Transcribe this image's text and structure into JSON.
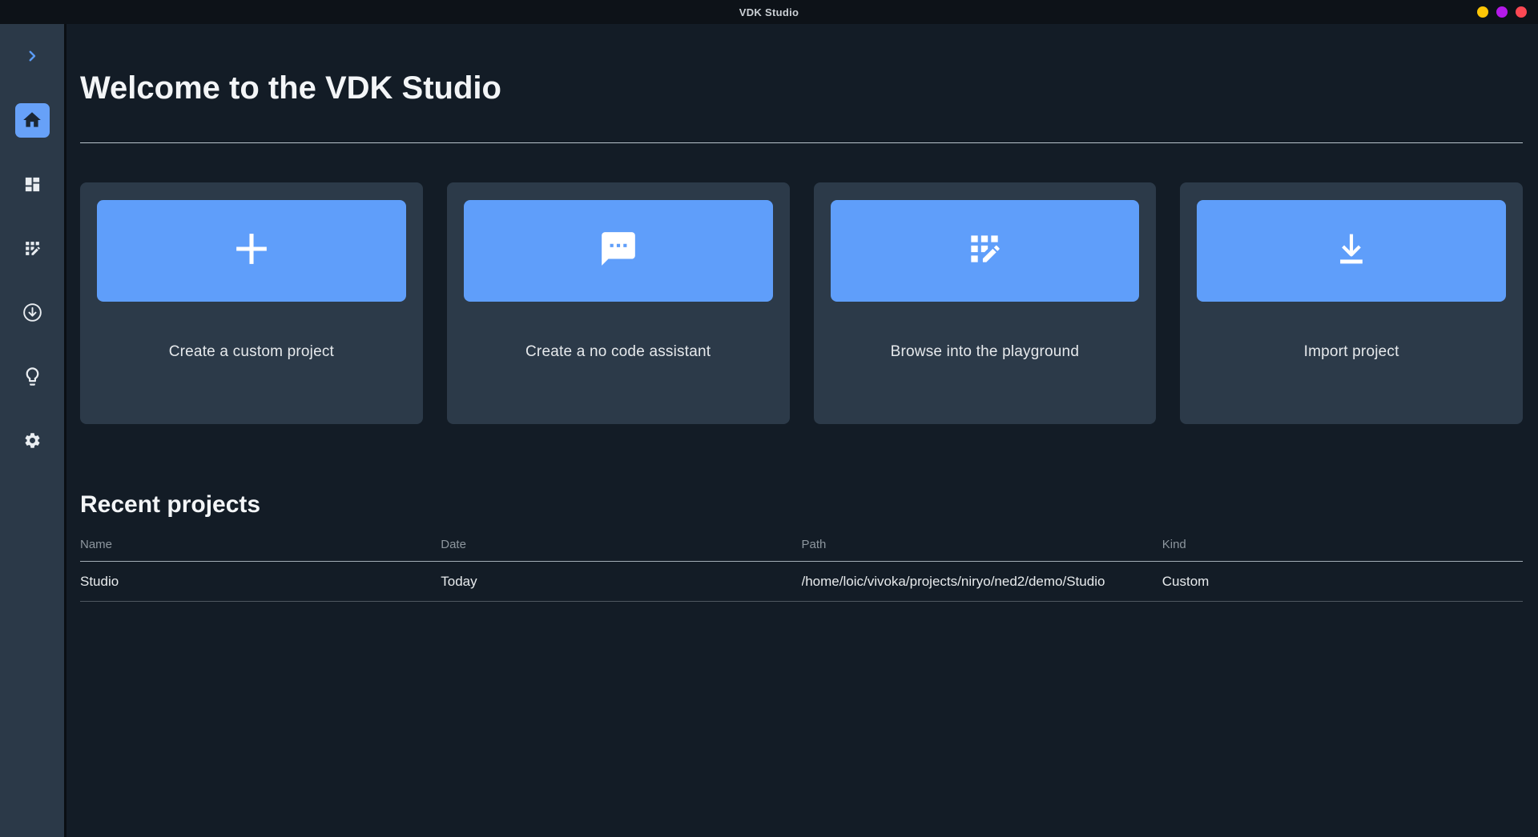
{
  "titlebar": {
    "title": "VDK Studio"
  },
  "window_controls": {
    "dots": [
      {
        "icon": "window-dot-yellow",
        "color": "#fdc606"
      },
      {
        "icon": "window-dot-purple",
        "color": "#b51aea"
      },
      {
        "icon": "window-dot-red",
        "color": "#fc4853"
      }
    ]
  },
  "sidebar": {
    "items": [
      {
        "icon": "chevron-right-icon",
        "active": false
      },
      {
        "icon": "home-icon",
        "active": true
      },
      {
        "icon": "dashboard-icon",
        "active": false
      },
      {
        "icon": "app-registration-icon",
        "active": false
      },
      {
        "icon": "download-circle-icon",
        "active": false
      },
      {
        "icon": "lightbulb-icon",
        "active": false
      },
      {
        "icon": "settings-gear-icon",
        "active": false
      }
    ]
  },
  "main": {
    "heading": "Welcome to the VDK Studio",
    "cards": [
      {
        "icon": "plus-icon",
        "label": "Create a custom project"
      },
      {
        "icon": "chat-icon",
        "label": "Create a no code assistant"
      },
      {
        "icon": "app-registration-icon",
        "label": "Browse into the playground"
      },
      {
        "icon": "download-icon",
        "label": "Import project"
      }
    ],
    "recent": {
      "heading": "Recent projects",
      "columns": [
        "Name",
        "Date",
        "Path",
        "Kind"
      ],
      "rows": [
        [
          "Studio",
          "Today",
          "/home/loic/vivoka/projects/niryo/ned2/demo/Studio",
          "Custom"
        ]
      ]
    }
  },
  "colors": {
    "titlebar_bg": "#0d1218",
    "main_bg": "#131c26",
    "sidebar_bg": "#2b3948",
    "card_bg": "#2c3a49",
    "accent_blue": "#5f9efa",
    "dot_yellow": "#fdc606",
    "dot_purple": "#b51aea",
    "dot_red": "#fc4853"
  }
}
